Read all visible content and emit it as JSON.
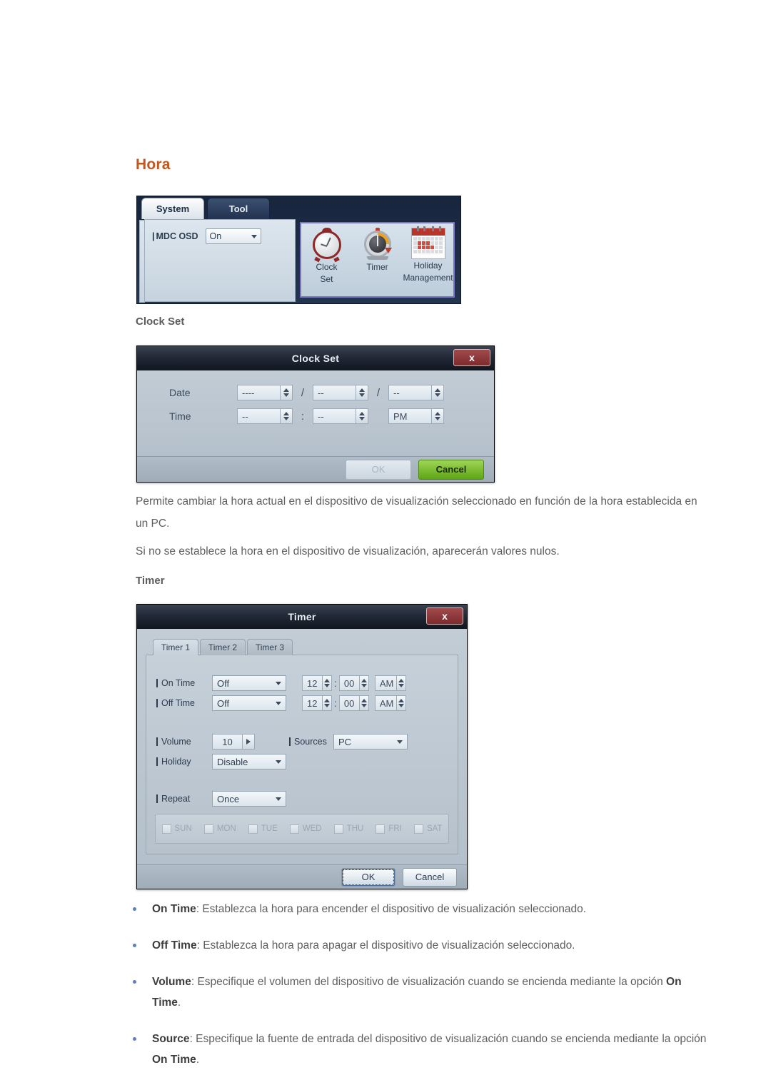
{
  "page": {
    "heading": "Hora",
    "accent_color": "#c2561e",
    "section_clock_set": "Clock Set",
    "section_timer": "Timer",
    "paragraph_1": "Permite cambiar la hora actual en el dispositivo de visualización seleccionado en función de la hora establecida en un PC.",
    "paragraph_2": "Si no se establece la hora en el dispositivo de visualización, aparecerán valores nulos."
  },
  "mdc_panel": {
    "tabs": [
      {
        "label": "System",
        "active": true
      },
      {
        "label": "Tool",
        "active": false
      }
    ],
    "osd": {
      "label": "MDC OSD",
      "value": "On"
    },
    "icons": [
      {
        "name": "clock-set-icon",
        "caption_line1": "Clock",
        "caption_line2": "Set"
      },
      {
        "name": "timer-icon",
        "caption_line1": "Timer",
        "caption_line2": ""
      },
      {
        "name": "holiday-management-icon",
        "caption_line1": "Holiday",
        "caption_line2": "Management"
      }
    ],
    "highlight_border_color": "#7b74c4"
  },
  "clock_set_dialog": {
    "title": "Clock Set",
    "close_label": "x",
    "date_label": "Date",
    "time_label": "Time",
    "date_year": "----",
    "date_month": "--",
    "date_day": "--",
    "date_sep": "/",
    "time_hour": "--",
    "time_minute": "--",
    "time_meridiem": "PM",
    "time_sep": ":",
    "ok_label": "OK",
    "cancel_label": "Cancel",
    "ok_enabled": false,
    "cancel_color": "#77c02a"
  },
  "timer_dialog": {
    "title": "Timer",
    "close_label": "x",
    "tabs": [
      {
        "label": "Timer 1",
        "active": true
      },
      {
        "label": "Timer 2",
        "active": false
      },
      {
        "label": "Timer 3",
        "active": false
      }
    ],
    "on_time": {
      "label": "On Time",
      "state": "Off",
      "hour": "12",
      "minute": "00",
      "meridiem": "AM"
    },
    "off_time": {
      "label": "Off Time",
      "state": "Off",
      "hour": "12",
      "minute": "00",
      "meridiem": "AM"
    },
    "volume": {
      "label": "Volume",
      "value": "10"
    },
    "sources": {
      "label": "Sources",
      "value": "PC"
    },
    "holiday": {
      "label": "Holiday",
      "value": "Disable"
    },
    "repeat": {
      "label": "Repeat",
      "value": "Once"
    },
    "days": [
      {
        "label": "SUN",
        "checked": false
      },
      {
        "label": "MON",
        "checked": false
      },
      {
        "label": "TUE",
        "checked": false
      },
      {
        "label": "WED",
        "checked": false
      },
      {
        "label": "THU",
        "checked": false
      },
      {
        "label": "FRI",
        "checked": false
      },
      {
        "label": "SAT",
        "checked": false
      }
    ],
    "ok_label": "OK",
    "cancel_label": "Cancel"
  },
  "bullets": [
    {
      "term": "On Time",
      "text": ": Establezca la hora para encender el dispositivo de visualización seleccionado."
    },
    {
      "term": "Off Time",
      "text": ": Establezca la hora para apagar el dispositivo de visualización seleccionado."
    },
    {
      "term": "Volume",
      "text": ": Especifique el volumen del dispositivo de visualización cuando se encienda mediante la opción ",
      "term2": "On Time",
      "text2": "."
    },
    {
      "term": "Source",
      "text": ": Especifique la fuente de entrada del dispositivo de visualización cuando se encienda mediante la opción ",
      "term2": "On Time",
      "text2": "."
    }
  ]
}
